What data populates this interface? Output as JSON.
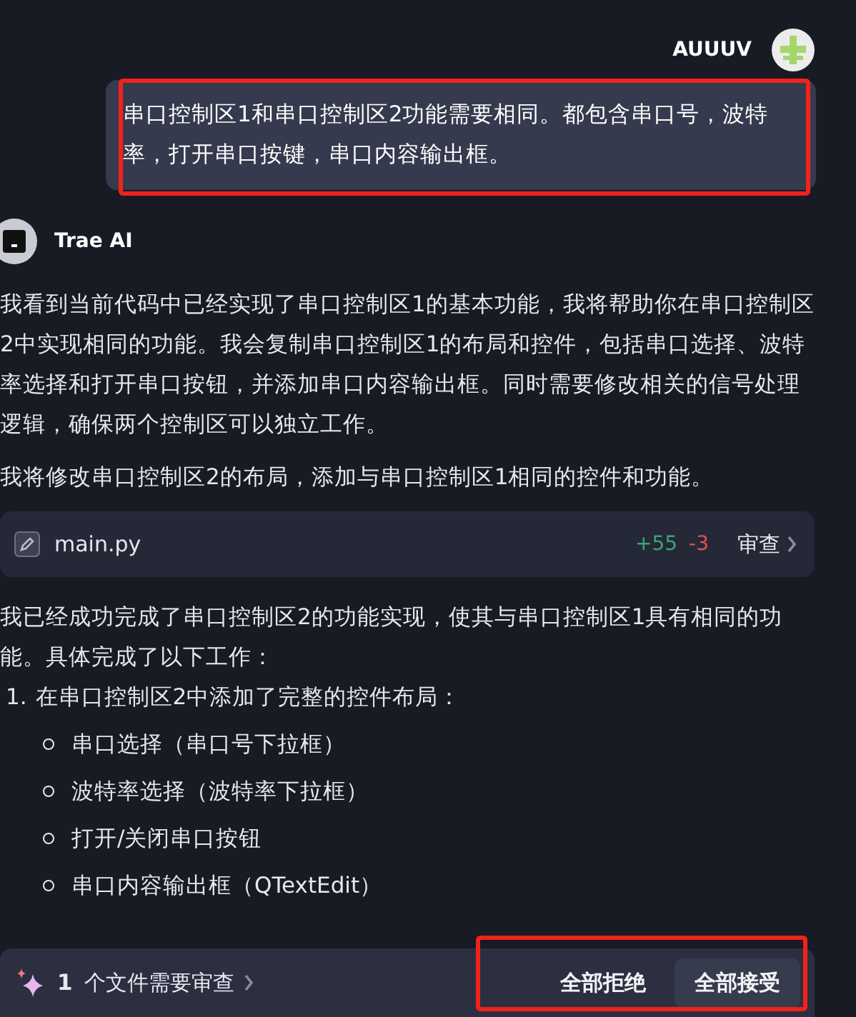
{
  "user_message": {
    "name": "AUUUV",
    "text": "串口控制区1和串口控制区2功能需要相同。都包含串口号，波特率，打开串口按键，串口内容输出框。"
  },
  "assistant": {
    "name": "Trae AI",
    "paragraphs": [
      "我看到当前代码中已经实现了串口控制区1的基本功能，我将帮助你在串口控制区2中实现相同的功能。我会复制串口控制区1的布局和控件，包括串口选择、波特率选择和打开串口按钮，并添加串口内容输出框。同时需要修改相关的信号处理逻辑，确保两个控制区可以独立工作。",
      "我将修改串口控制区2的布局，添加与串口控制区1相同的控件和功能。"
    ],
    "file_change": {
      "file": "main.py",
      "added": "+55",
      "removed": "-3",
      "action": "审查"
    },
    "summary": "我已经成功完成了串口控制区2的功能实现，使其与串口控制区1具有相同的功能。具体完成了以下工作：",
    "list": [
      {
        "number": "1.",
        "text": "在串口控制区2中添加了完整的控件布局：",
        "children": [
          {
            "text": "串口选择（串口号下拉框）"
          },
          {
            "text": "波特率选择（波特率下拉框）"
          },
          {
            "text": "打开/关闭串口按钮"
          },
          {
            "text": "串口内容输出框（QTextEdit）"
          }
        ]
      }
    ]
  },
  "review_bar": {
    "count": "1",
    "label": "个文件需要审查",
    "buttons": [
      {
        "label": "全部拒绝",
        "primary": false
      },
      {
        "label": "全部接受",
        "primary": true
      }
    ]
  }
}
